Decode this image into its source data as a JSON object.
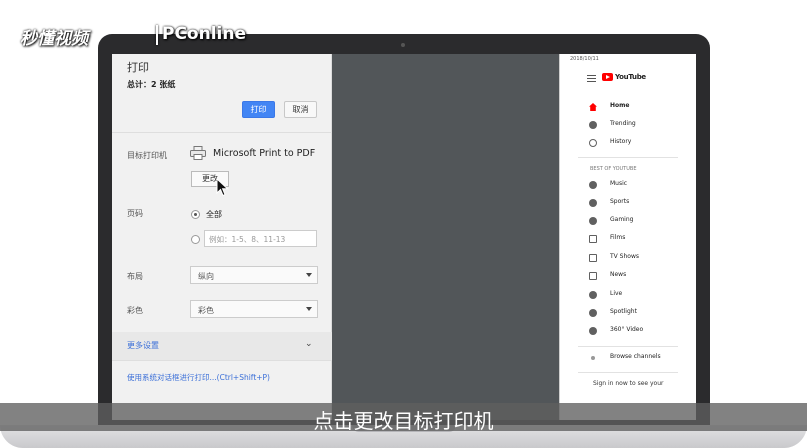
{
  "watermark": {
    "brand": "秒懂视频",
    "partner": "PConline"
  },
  "caption": "点击更改目标打印机",
  "print_dialog": {
    "title": "打印",
    "total": "总计：2 张纸",
    "print_button": "打印",
    "cancel_button": "取消",
    "destination_label": "目标打印机",
    "printer_name": "Microsoft Print to PDF",
    "change_button": "更改",
    "pages_label": "页码",
    "pages_all": "全部",
    "pages_placeholder": "例如：1-5、8、11-13",
    "layout_label": "布局",
    "layout_value": "纵向",
    "color_label": "彩色",
    "color_value": "彩色",
    "more_settings": "更多设置",
    "system_dialog_link": "使用系统对话框进行打印...(Ctrl+Shift+P)"
  },
  "youtube": {
    "date": "2018/10/11",
    "brand": "YouTube",
    "main_items": [
      {
        "label": "Home",
        "icon": "home-icon"
      },
      {
        "label": "Trending",
        "icon": "trending-icon"
      },
      {
        "label": "History",
        "icon": "history-icon"
      }
    ],
    "best_heading": "BEST OF YOUTUBE",
    "best_items": [
      {
        "label": "Music",
        "icon": "music-icon"
      },
      {
        "label": "Sports",
        "icon": "sports-icon"
      },
      {
        "label": "Gaming",
        "icon": "gaming-icon"
      },
      {
        "label": "Films",
        "icon": "films-icon"
      },
      {
        "label": "TV Shows",
        "icon": "tv-icon"
      },
      {
        "label": "News",
        "icon": "news-icon"
      },
      {
        "label": "Live",
        "icon": "live-icon"
      },
      {
        "label": "Spotlight",
        "icon": "spotlight-icon"
      },
      {
        "label": "360° Video",
        "icon": "360-icon"
      }
    ],
    "browse": "Browse channels",
    "signin": "Sign in now to see your"
  }
}
